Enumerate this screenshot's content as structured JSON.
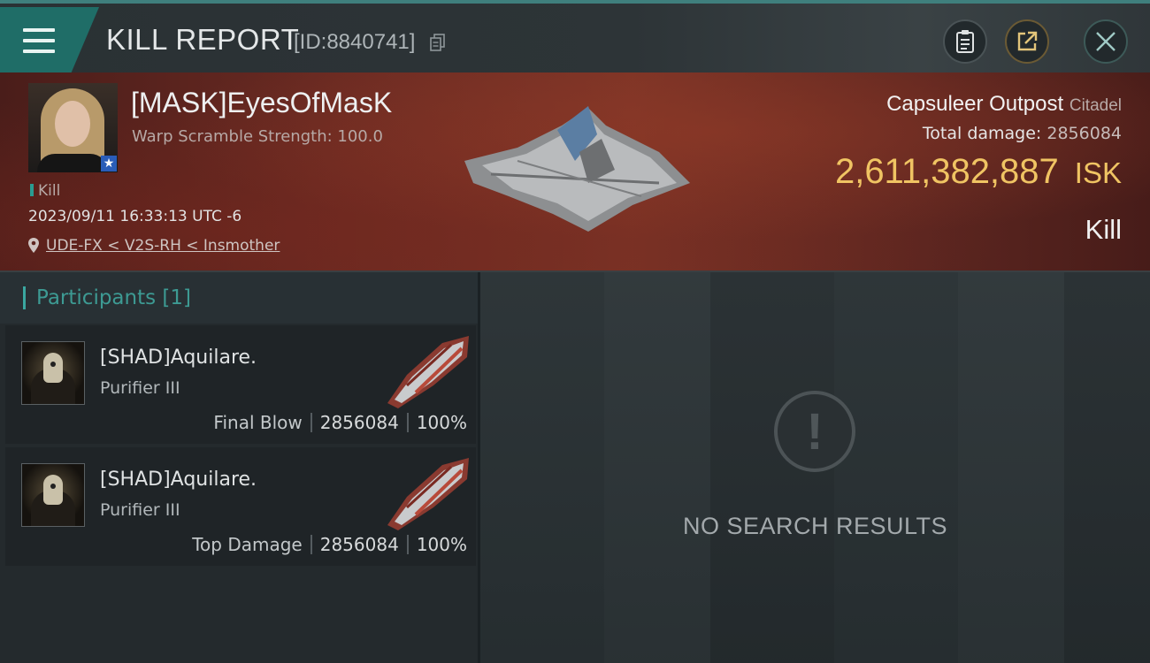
{
  "header": {
    "title": "KILL REPORT",
    "report_id": "[ID:8840741]"
  },
  "victim": {
    "name": "[MASK]EyesOfMasK",
    "warp_scramble": "Warp Scramble Strength: 100.0",
    "tag": "Kill",
    "timestamp": "2023/09/11 16:33:13 UTC -6",
    "location": "UDE-FX < V2S-RH < Insmother",
    "structure_name": "Capsuleer Outpost",
    "structure_class": "Citadel",
    "total_damage_label": "Total damage:",
    "total_damage_value": "2856084",
    "isk_value": "2,611,382,887",
    "isk_unit": "ISK",
    "result": "Kill"
  },
  "participants": {
    "title": "Participants",
    "count": "[1]",
    "items": [
      {
        "name": "[SHAD]Aquilare.",
        "ship": "Purifier III",
        "label": "Final Blow",
        "damage": "2856084",
        "percent": "100%"
      },
      {
        "name": "[SHAD]Aquilare.",
        "ship": "Purifier III",
        "label": "Top Damage",
        "damage": "2856084",
        "percent": "100%"
      }
    ]
  },
  "results": {
    "empty_text": "NO SEARCH RESULTS"
  },
  "icons": {
    "menu": "menu-icon",
    "copy": "copy-icon",
    "clipboard": "clipboard-icon",
    "share": "share-icon",
    "close": "close-icon",
    "location": "location-pin-icon",
    "warning": "exclamation-icon"
  },
  "colors": {
    "accent_teal": "#3aa7a0",
    "isk_gold": "#f0c463",
    "banner_red": "#6a2a22"
  }
}
